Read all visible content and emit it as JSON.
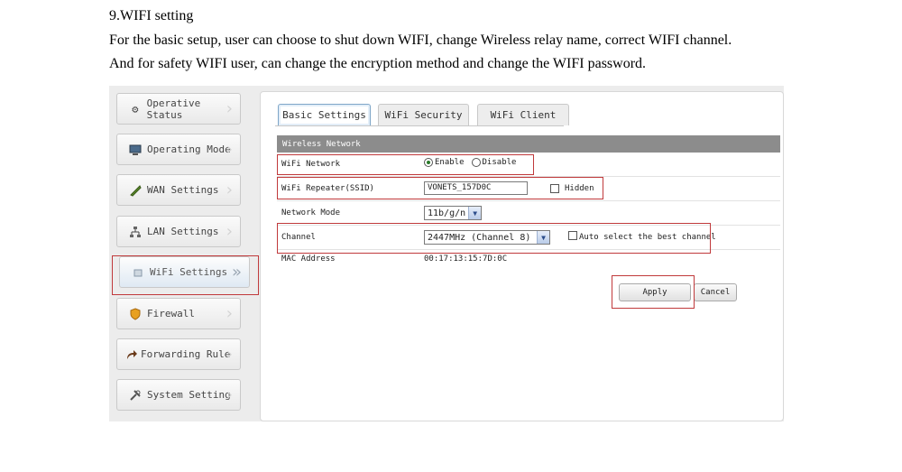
{
  "doc": {
    "heading": "9.WIFI setting",
    "para1": "For the basic setup, user can choose to shut down WIFI, change Wireless relay name, correct WIFI channel.",
    "para2": "And for safety WIFI user, can change the encryption method and change the WIFI password."
  },
  "sidebar": {
    "items": [
      {
        "label": "Operative Status",
        "icon": "gear-icon"
      },
      {
        "label": "Operating Mode",
        "icon": "monitor-icon"
      },
      {
        "label": "WAN Settings",
        "icon": "tool-icon"
      },
      {
        "label": "LAN Settings",
        "icon": "network-icon"
      },
      {
        "label": "WiFi Settings",
        "icon": "wifi-icon"
      },
      {
        "label": "Firewall",
        "icon": "shield-icon"
      },
      {
        "label": "Forwarding Rule",
        "icon": "forward-icon"
      },
      {
        "label": "System Setting",
        "icon": "wrench-icon"
      }
    ]
  },
  "tabs": [
    {
      "label": "Basic Settings"
    },
    {
      "label": "WiFi Security"
    },
    {
      "label": "WiFi Client"
    }
  ],
  "section_title": "Wireless Network",
  "fields": {
    "wifi_network": {
      "label": "WiFi Network",
      "enable": "Enable",
      "disable": "Disable",
      "selected": "Enable"
    },
    "repeater": {
      "label": "WiFi Repeater(SSID)",
      "value": "VONETS_157D0C",
      "hidden_label": "Hidden",
      "hidden_checked": false
    },
    "mode": {
      "label": "Network Mode",
      "value": "11b/g/n"
    },
    "channel": {
      "label": "Channel",
      "value": "2447MHz (Channel 8)",
      "auto_label": "Auto select the best channel",
      "auto_checked": false
    },
    "mac": {
      "label": "MAC Address",
      "value": "00:17:13:15:7D:0C"
    }
  },
  "buttons": {
    "apply": "Apply",
    "cancel": "Cancel"
  },
  "colors": {
    "highlight": "#c0393b",
    "header": "#8c8c8c"
  }
}
